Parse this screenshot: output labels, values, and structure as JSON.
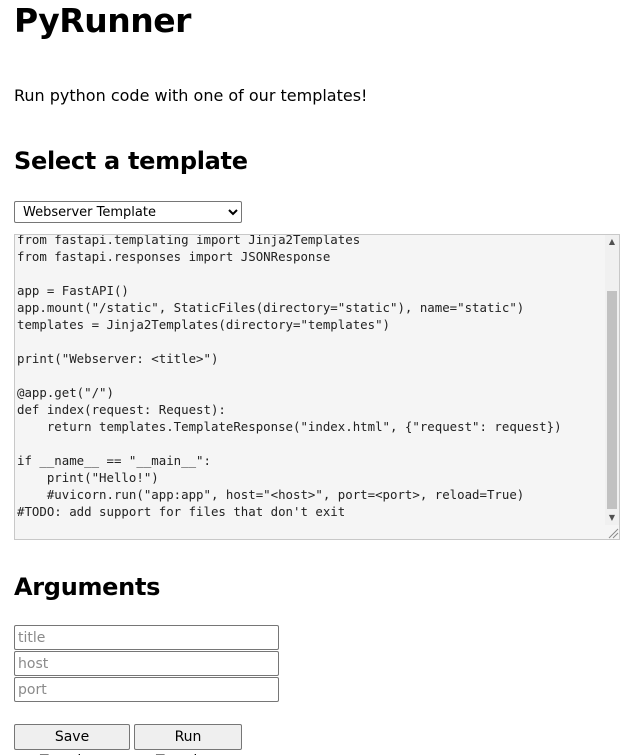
{
  "header": {
    "title": "PyRunner",
    "subtitle": "Run python code with one of our templates!"
  },
  "template_section": {
    "heading": "Select a template",
    "selected": "Webserver Template",
    "options": [
      "Webserver Template"
    ]
  },
  "code": {
    "content": "from fastapi.templating import Jinja2Templates\nfrom fastapi.responses import JSONResponse\n\napp = FastAPI()\napp.mount(\"/static\", StaticFiles(directory=\"static\"), name=\"static\")\ntemplates = Jinja2Templates(directory=\"templates\")\n\nprint(\"Webserver: <title>\")\n\n@app.get(\"/\")\ndef index(request: Request):\n    return templates.TemplateResponse(\"index.html\", {\"request\": request})\n\nif __name__ == \"__main__\":\n    print(\"Hello!\")\n    #uvicorn.run(\"app:app\", host=\"<host>\", port=<port>, reload=True)\n#TODO: add support for files that don't exit",
    "scroll_fraction": 0.9
  },
  "arguments_section": {
    "heading": "Arguments",
    "title_placeholder": "title",
    "host_placeholder": "host",
    "port_placeholder": "port",
    "title_value": "",
    "host_value": "",
    "port_value": ""
  },
  "actions": {
    "save_label": "Save Template",
    "run_label": "Run Template"
  },
  "icons": {
    "scroll_up": "scroll-up-arrow-icon",
    "scroll_down": "scroll-down-arrow-icon",
    "resize": "resize-grip-icon"
  }
}
